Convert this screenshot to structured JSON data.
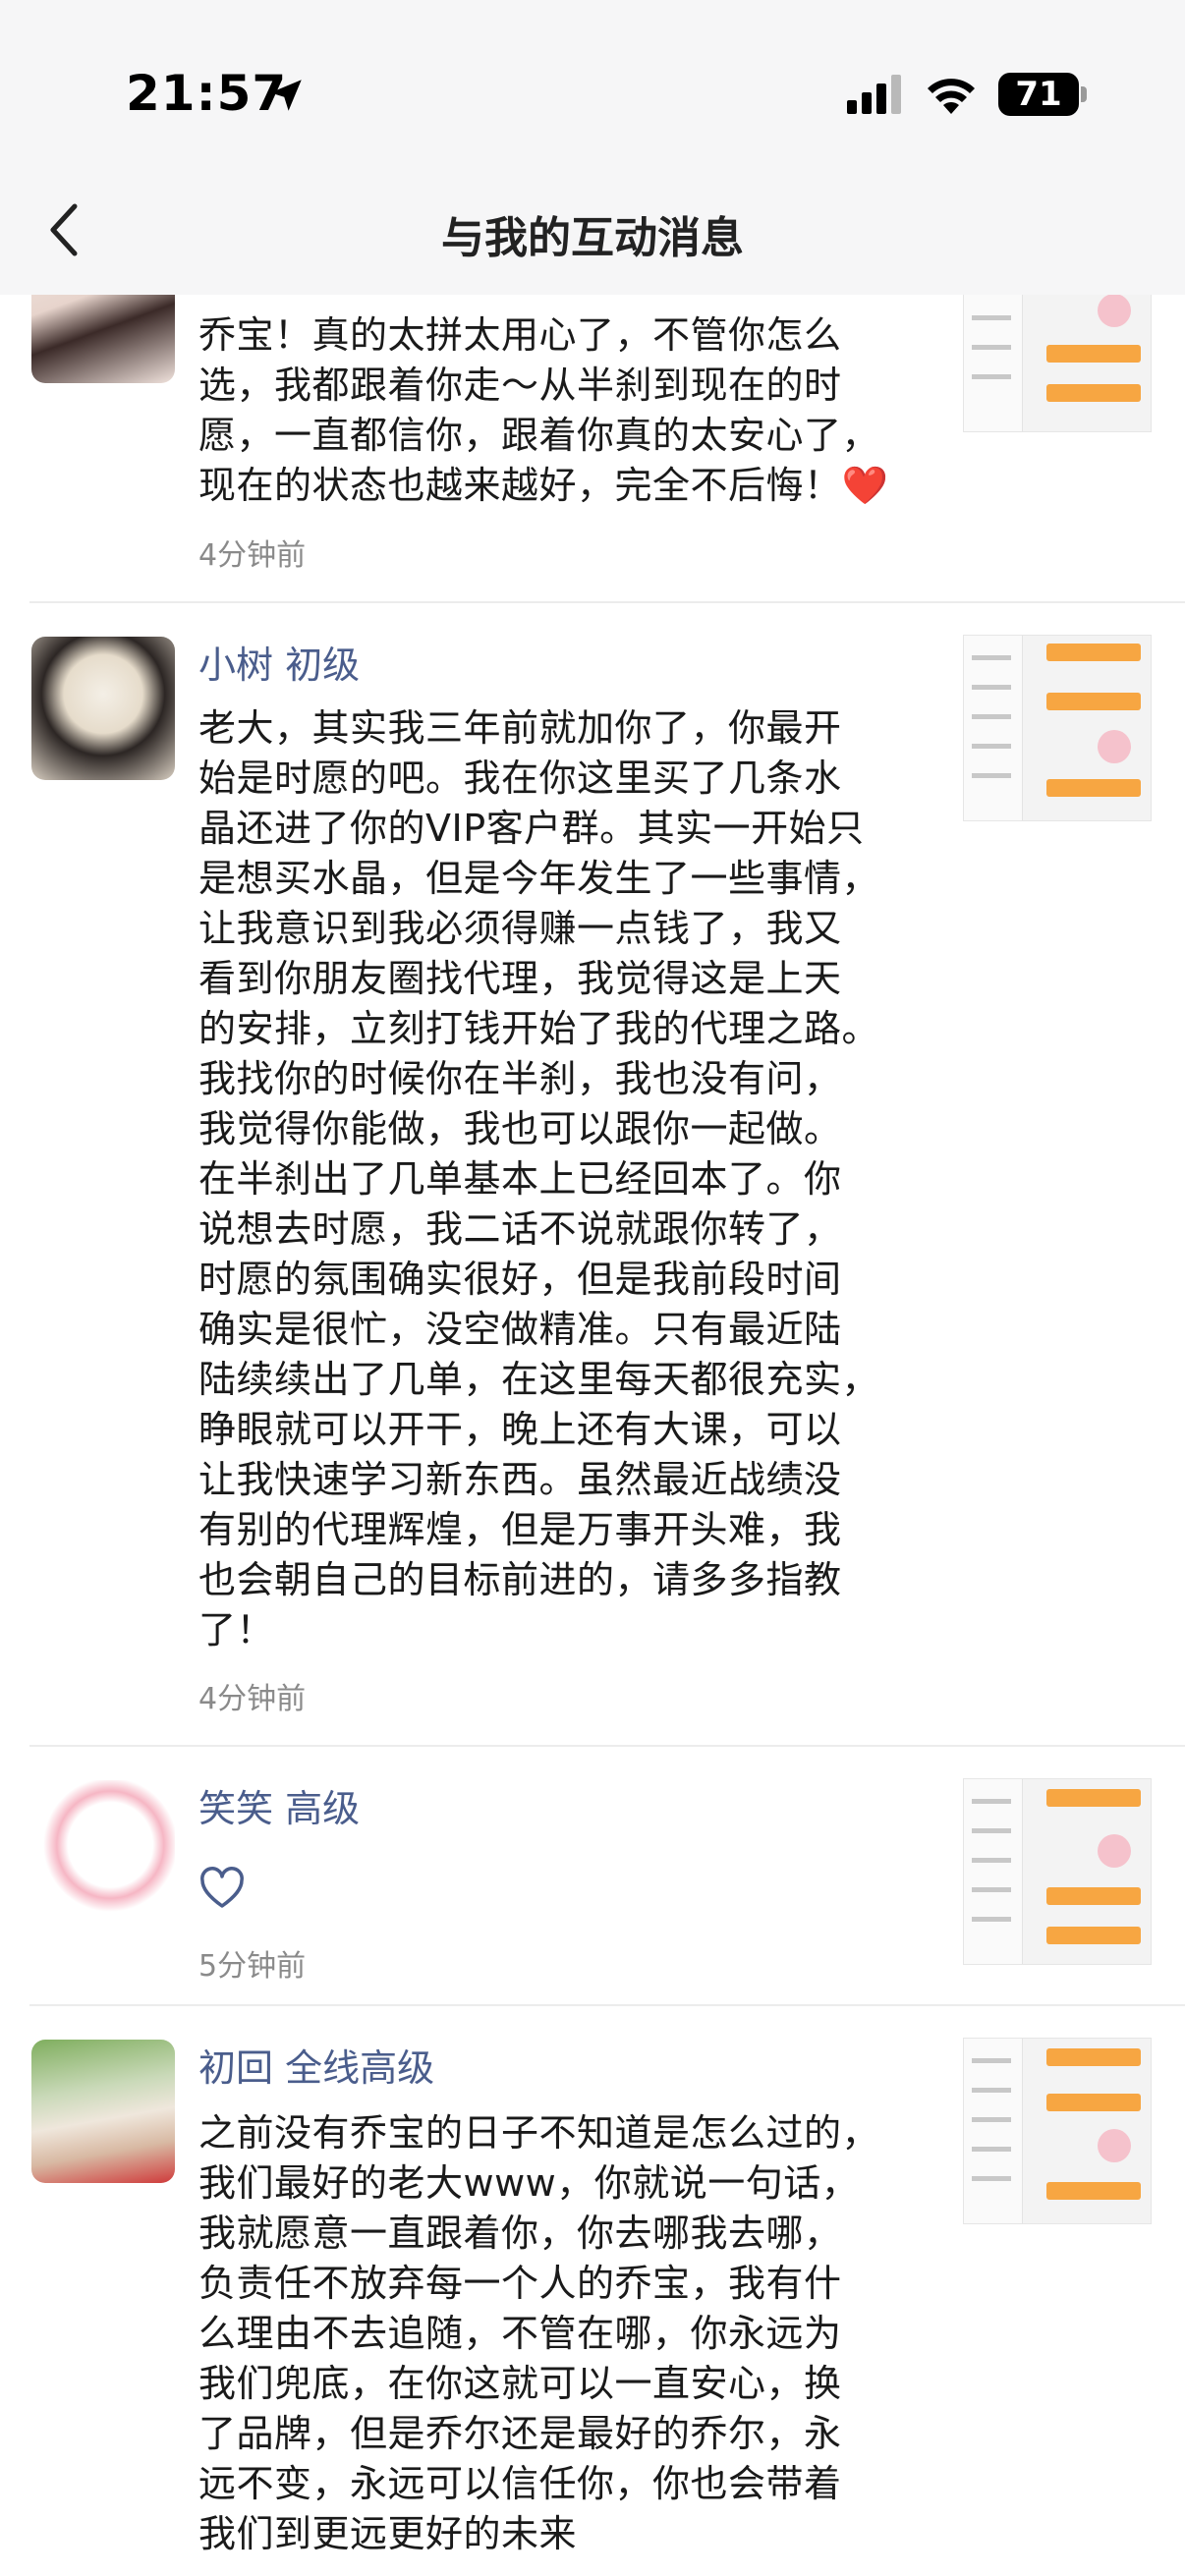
{
  "status_bar": {
    "time": "21:57",
    "battery": "71"
  },
  "nav": {
    "title": "与我的互动消息"
  },
  "items": [
    {
      "name": "",
      "lines": [
        "乔宝！真的太拼太用心了，不管你怎么",
        "选，我都跟着你走～从半刹到现在的时",
        "愿，一直都信你，跟着你真的太安心了，",
        "现在的状态也越来越好，完全不后悔！"
      ],
      "emoji": "❤️",
      "time": "4分钟前"
    },
    {
      "name": "小树 初级",
      "lines": [
        "老大，其实我三年前就加你了，你最开",
        "始是时愿的吧。我在你这里买了几条水",
        "晶还进了你的VIP客户群。其实一开始只",
        "是想买水晶，但是今年发生了一些事情，",
        "让我意识到我必须得赚一点钱了，我又",
        "看到你朋友圈找代理，我觉得这是上天",
        "的安排，立刻打钱开始了我的代理之路。",
        "我找你的时候你在半刹，我也没有问，",
        "我觉得你能做，我也可以跟你一起做。",
        "在半刹出了几单基本上已经回本了。你",
        "说想去时愿，我二话不说就跟你转了，",
        "时愿的氛围确实很好，但是我前段时间",
        "确实是很忙，没空做精准。只有最近陆",
        "陆续续出了几单，在这里每天都很充实，",
        "睁眼就可以开干，晚上还有大课，可以",
        "让我快速学习新东西。虽然最近战绩没",
        "有别的代理辉煌，但是万事开头难，我",
        "也会朝自己的目标前进的，请多多指教",
        "了！"
      ],
      "time": "4分钟前"
    },
    {
      "name": "笑笑 高级",
      "lines": [],
      "time": "5分钟前"
    },
    {
      "name": "初回 全线高级",
      "lines": [
        "之前没有乔宝的日子不知道是怎么过的，",
        "我们最好的老大www，你就说一句话，",
        "我就愿意一直跟着你，你去哪我去哪，",
        "负责任不放弃每一个人的乔宝，我有什",
        "么理由不去追随，不管在哪，你永远为",
        "我们兜底，在你这就可以一直安心，换",
        "了品牌，但是乔尔还是最好的乔尔，永",
        "远不变，永远可以信任你，你也会带着",
        "我们到更远更好的未来"
      ],
      "time": ""
    }
  ]
}
